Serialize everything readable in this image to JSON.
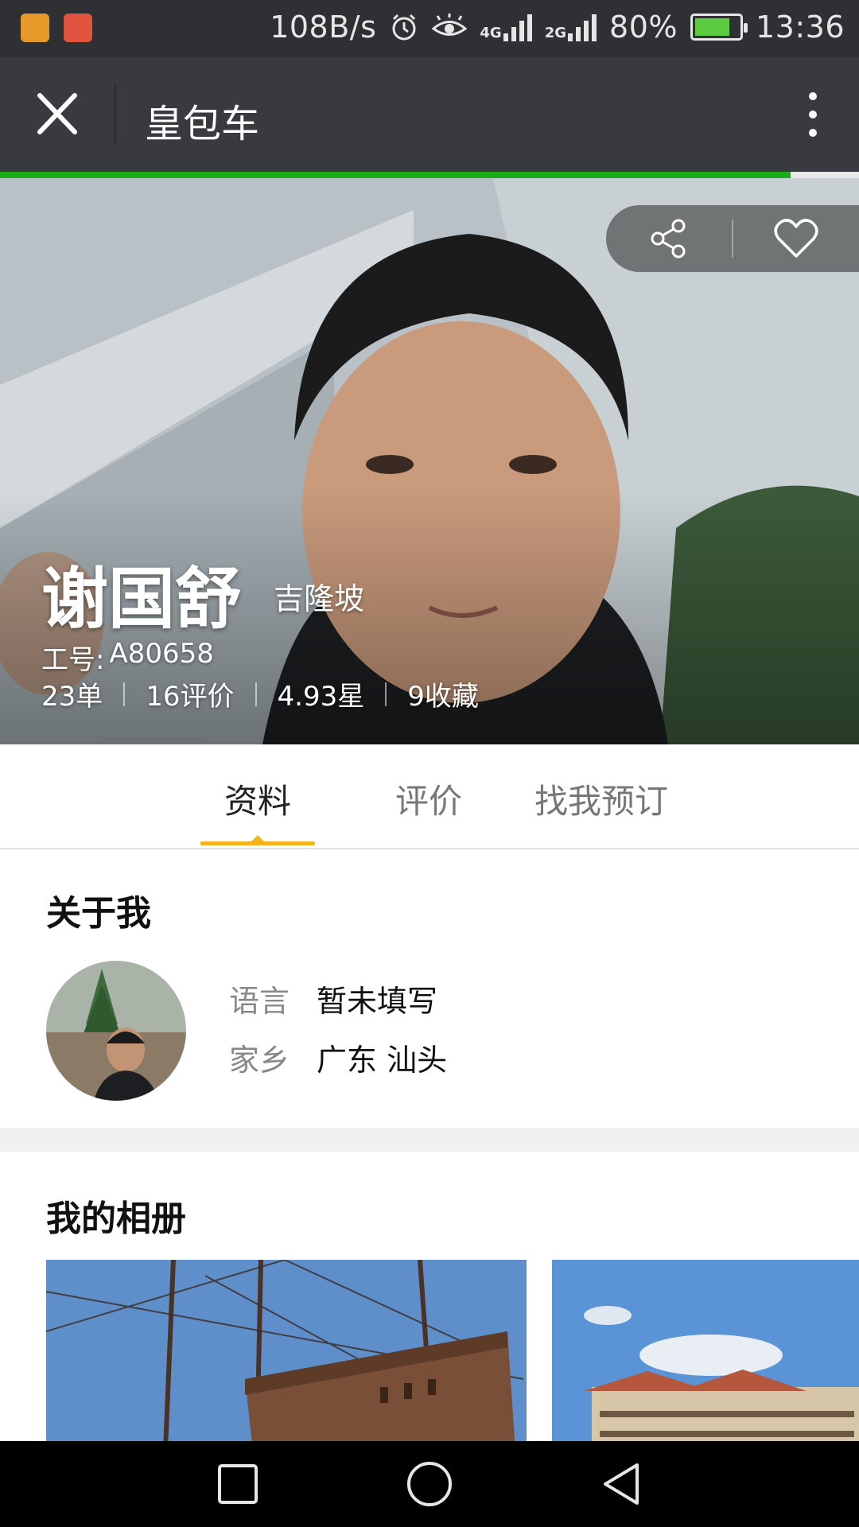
{
  "status_bar": {
    "net_speed": "108B/s",
    "net1": "4G",
    "net2": "2G",
    "battery": "80%",
    "battery_level": 0.8,
    "time": "13:36"
  },
  "header": {
    "title": "皇包车",
    "page_load_progress": 0.92
  },
  "profile": {
    "name": "谢国舒",
    "city": "吉隆坡",
    "id_label": "工号:",
    "id_value": "A80658",
    "stats": {
      "orders": "23单",
      "reviews": "16评价",
      "rating": "4.93星",
      "favorites": "9收藏"
    }
  },
  "tabs": [
    {
      "label": "资料",
      "active": true
    },
    {
      "label": "评价",
      "active": false
    },
    {
      "label": "找我预订",
      "active": false
    }
  ],
  "about": {
    "title": "关于我",
    "language_label": "语言",
    "language_value": "暂未填写",
    "hometown_label": "家乡",
    "hometown_value": "广东 汕头"
  },
  "album": {
    "title": "我的相册"
  },
  "colors": {
    "accent_green": "#1aad19",
    "tab_underline": "#f5b41e",
    "title_bar": "#393a3f"
  }
}
